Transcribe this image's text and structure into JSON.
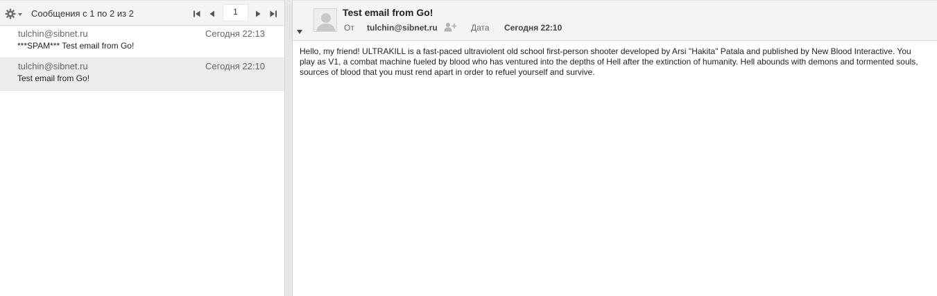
{
  "list": {
    "count_text": "Сообщения с 1 по 2 из 2",
    "page_value": "1",
    "icons": {
      "settings": "gear-icon",
      "first": "first-page-icon",
      "prev": "previous-page-icon",
      "next": "next-page-icon",
      "last": "last-page-icon"
    },
    "messages": [
      {
        "from": "tulchin@sibnet.ru",
        "date": "Сегодня 22:13",
        "subject": "***SPAM*** Test email from Go!",
        "selected": false
      },
      {
        "from": "tulchin@sibnet.ru",
        "date": "Сегодня 22:10",
        "subject": "Test email from Go!",
        "selected": true
      }
    ]
  },
  "view": {
    "subject": "Test email from Go!",
    "from_label": "От",
    "from_address": "tulchin@sibnet.ru",
    "date_label": "Дата",
    "date_value": "Сегодня 22:10",
    "body": "Hello, my friend! ULTRAKILL is a fast-paced ultraviolent old school first-person shooter developed by Arsi \"Hakita\" Patala and published by New Blood Interactive. You play as V1, a combat machine fueled by blood who has ventured into the depths of Hell after the extinction of humanity. Hell abounds with demons and tormented souls, sources of blood that you must rend apart in order to refuel yourself and survive.",
    "icons": {
      "avatar": "person-silhouette-icon",
      "add_contact": "add-contact-icon",
      "collapse": "caret-down-icon"
    }
  },
  "colors": {
    "toolbar_bg": "#f4f4f4",
    "selected_row_bg": "#ececec",
    "splitter_bg": "#e6e6e6",
    "muted_text": "#666666",
    "icon_gray": "#6f6f6f"
  }
}
